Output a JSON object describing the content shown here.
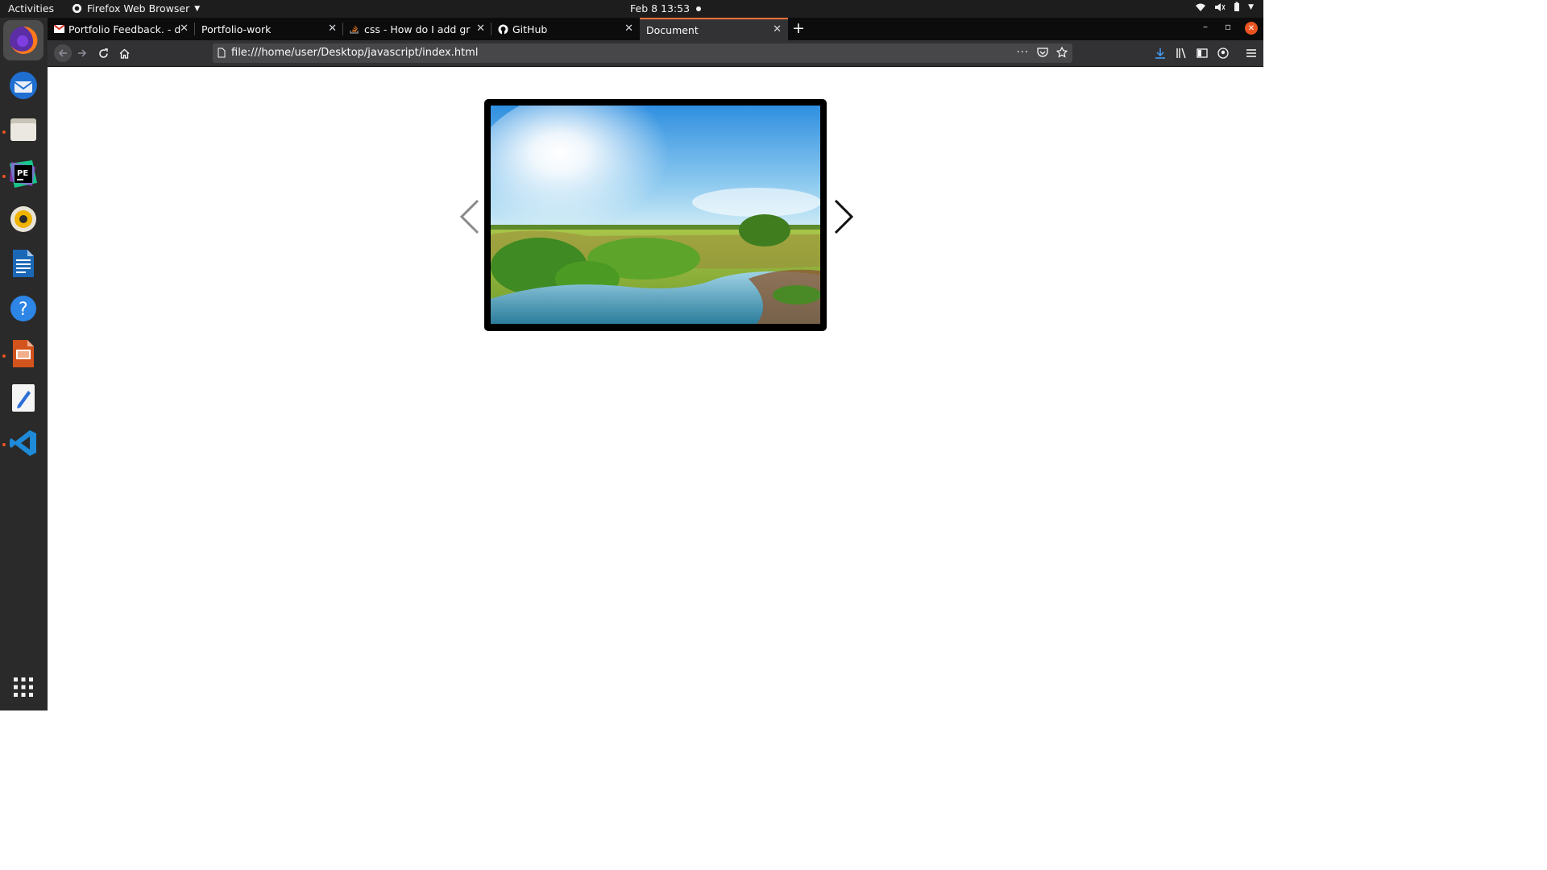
{
  "topbar": {
    "activities": "Activities",
    "app_name": "Firefox Web Browser",
    "clock": "Feb 8  13:53"
  },
  "browser": {
    "tabs": [
      {
        "title": "Portfolio Feedback. - dal",
        "favicon": "gmail-icon",
        "selected": false
      },
      {
        "title": "Portfolio-work",
        "favicon": "",
        "selected": false
      },
      {
        "title": "css - How do I add grid in",
        "favicon": "stackoverflow-icon",
        "selected": false
      },
      {
        "title": "GitHub",
        "favicon": "github-icon",
        "selected": false
      },
      {
        "title": "Document",
        "favicon": "",
        "selected": true
      }
    ],
    "url": "file:///home/user/Desktop/javascript/index.html"
  },
  "dock": {
    "apps": [
      "firefox-icon",
      "thunderbird-icon",
      "files-icon",
      "phpstorm-icon",
      "rhythmbox-icon",
      "writer-icon",
      "help-icon",
      "impress-icon",
      "text-editor-icon",
      "vscode-icon",
      "app-grid-icon"
    ]
  },
  "page": {
    "slide_image": "landscape-sun-river-image",
    "prev_arrow": "chevron-left-icon",
    "next_arrow": "chevron-right-icon"
  },
  "colors": {
    "accent": "#ff7139",
    "ubuntu_orange": "#e95420"
  }
}
